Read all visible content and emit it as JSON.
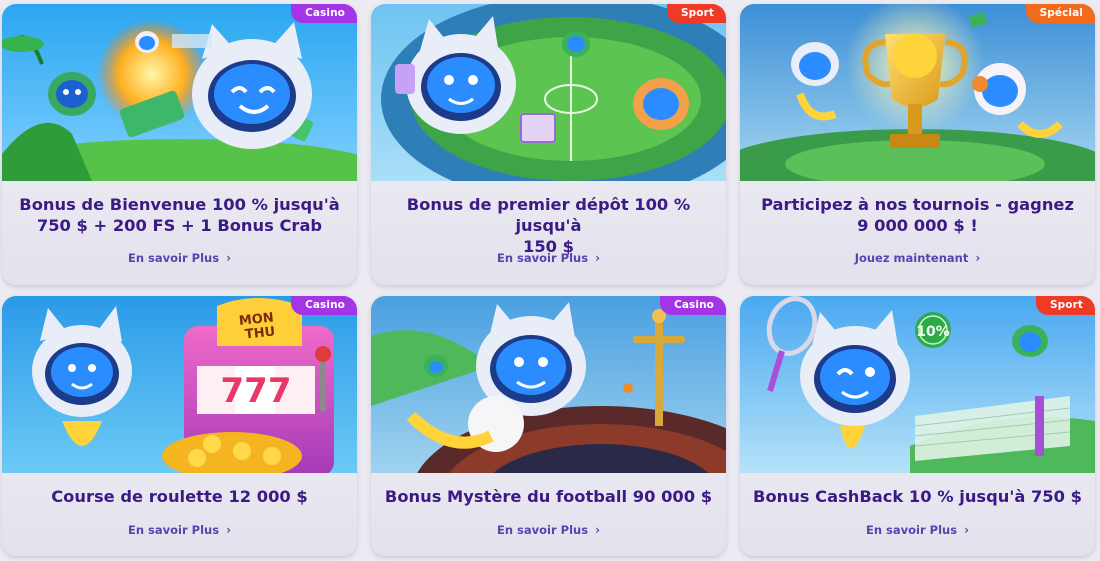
{
  "colors": {
    "title": "#3b1a86",
    "cta": "#5b42b2",
    "badge_casino": "#a335e6",
    "badge_sport": "#ef3a25",
    "badge_special": "#f26a1a"
  },
  "cards": [
    {
      "badge": "Casino",
      "title_line1": "Bonus de Bienvenue 100 % jusqu'à",
      "title_line2": "750 $ + 200 FS + 1 Bonus Crab",
      "cta": "En savoir Plus",
      "art_icon": "astronaut-cat-with-money-icon"
    },
    {
      "badge": "Sport",
      "title_line1": "Bonus de premier dépôt 100 % jusqu'à",
      "title_line2": "150 $",
      "cta": "En savoir Plus",
      "art_icon": "astronaut-cat-stadium-icon"
    },
    {
      "badge": "Spécial",
      "title_line1": "Participez à nos tournois - gagnez",
      "title_line2": "9 000 000 $ !",
      "cta": "Jouez maintenant",
      "art_icon": "trophy-icon"
    },
    {
      "badge": "Casino",
      "title_line1": "Course de roulette 12 000 $",
      "title_line2": "",
      "cta": "En savoir Plus",
      "art_icon": "slot-machine-icon",
      "slot_sign": "MON THU",
      "slot_reels": "777"
    },
    {
      "badge": "Casino",
      "title_line1": "Bonus Mystère du football 90 000 $",
      "title_line2": "",
      "cta": "En savoir Plus",
      "art_icon": "roulette-wheel-icon"
    },
    {
      "badge": "Sport",
      "title_line1": "Bonus CashBack 10 % jusqu'à 750 $",
      "title_line2": "",
      "cta": "En savoir Plus",
      "art_icon": "tennis-racket-icon",
      "percent_ball": "10%"
    }
  ]
}
